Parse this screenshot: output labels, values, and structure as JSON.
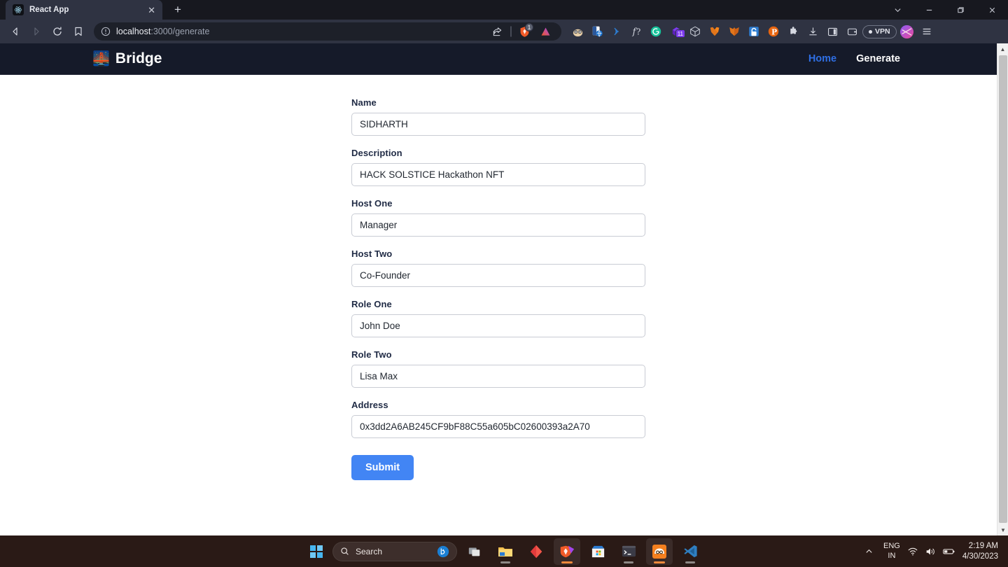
{
  "browser": {
    "tab": {
      "title": "React App",
      "favicon_icon": "react-logo-icon",
      "close_icon": "close-icon"
    },
    "new_tab_label": "+",
    "window_controls": {
      "tab_search": "tab-search-chevron-icon",
      "minimize": "minimize-icon",
      "maximize": "maximize-icon",
      "close": "close-icon"
    },
    "nav": {
      "back_icon": "back-arrow-icon",
      "forward_icon": "forward-arrow-icon",
      "reload_icon": "reload-icon",
      "bookmark_icon": "bookmark-icon"
    },
    "omnibox": {
      "info_icon": "site-info-icon",
      "url_host": "localhost",
      "url_path": ":3000/generate",
      "share_icon": "share-icon"
    },
    "shields": {
      "icon": "brave-shields-icon",
      "count": "1"
    },
    "brave_icon": "brave-leo-icon",
    "extensions": [
      {
        "name": "metamask-fox-icon"
      },
      {
        "name": "translate-icon"
      },
      {
        "name": "wifi-cast-icon"
      },
      {
        "name": "function-icon"
      },
      {
        "name": "grammarly-icon"
      },
      {
        "name": "bookmark-manager-icon",
        "badge": "11"
      },
      {
        "name": "cube-icon"
      },
      {
        "name": "fox-wallet-icon"
      },
      {
        "name": "password-manager-icon"
      },
      {
        "name": "pinterest-icon"
      },
      {
        "name": "extensions-puzzle-icon"
      },
      {
        "name": "downloads-icon"
      },
      {
        "name": "sidebar-icon"
      },
      {
        "name": "wallet-icon"
      }
    ],
    "vpn": {
      "label": "VPN"
    },
    "profile_icon": "profile-avatar-icon",
    "menu_icon": "hamburger-menu-icon"
  },
  "page": {
    "navbar": {
      "brand": "Bridge",
      "brand_logo_icon": "bridge-at-night-icon",
      "links": [
        {
          "label": "Home",
          "active": true
        },
        {
          "label": "Generate",
          "active": false
        }
      ]
    },
    "form": {
      "fields": [
        {
          "label": "Name",
          "value": "SIDHARTH",
          "name": "name"
        },
        {
          "label": "Description",
          "value": "HACK SOLSTICE Hackathon NFT",
          "name": "description"
        },
        {
          "label": "Host One",
          "value": "Manager",
          "name": "host-one"
        },
        {
          "label": "Host Two",
          "value": "Co-Founder",
          "name": "host-two"
        },
        {
          "label": "Role One",
          "value": "John Doe",
          "name": "role-one"
        },
        {
          "label": "Role Two",
          "value": "Lisa Max",
          "name": "role-two"
        },
        {
          "label": "Address",
          "value": "0x3dd2A6AB245CF9bF88C55a605bC02600393a2A70",
          "name": "address"
        }
      ],
      "submit_label": "Submit"
    },
    "colors": {
      "navbar_bg": "#151a29",
      "link_active": "#2f6fe4",
      "submit_bg": "#4285f4",
      "label_text": "#1f2a44"
    }
  },
  "taskbar": {
    "start_icon": "windows-start-icon",
    "search": {
      "icon": "search-icon",
      "placeholder": "Search"
    },
    "bing_icon": "bing-chat-icon",
    "apps": [
      {
        "name": "task-view-icon",
        "active": false
      },
      {
        "name": "file-explorer-icon",
        "active": false
      },
      {
        "name": "ruby-gem-icon",
        "active": false
      },
      {
        "name": "brave-browser-icon",
        "active": true
      },
      {
        "name": "microsoft-store-icon",
        "active": false
      },
      {
        "name": "terminal-icon",
        "active": false
      },
      {
        "name": "hardhat-icon",
        "active": true
      },
      {
        "name": "vs-code-icon",
        "active": false
      }
    ],
    "tray": {
      "chevron_icon": "show-hidden-icons-chevron",
      "language_line1": "ENG",
      "language_line2": "IN",
      "wifi_icon": "wifi-icon",
      "volume_icon": "volume-icon",
      "battery_icon": "battery-icon",
      "time": "2:19 AM",
      "date": "4/30/2023"
    }
  }
}
